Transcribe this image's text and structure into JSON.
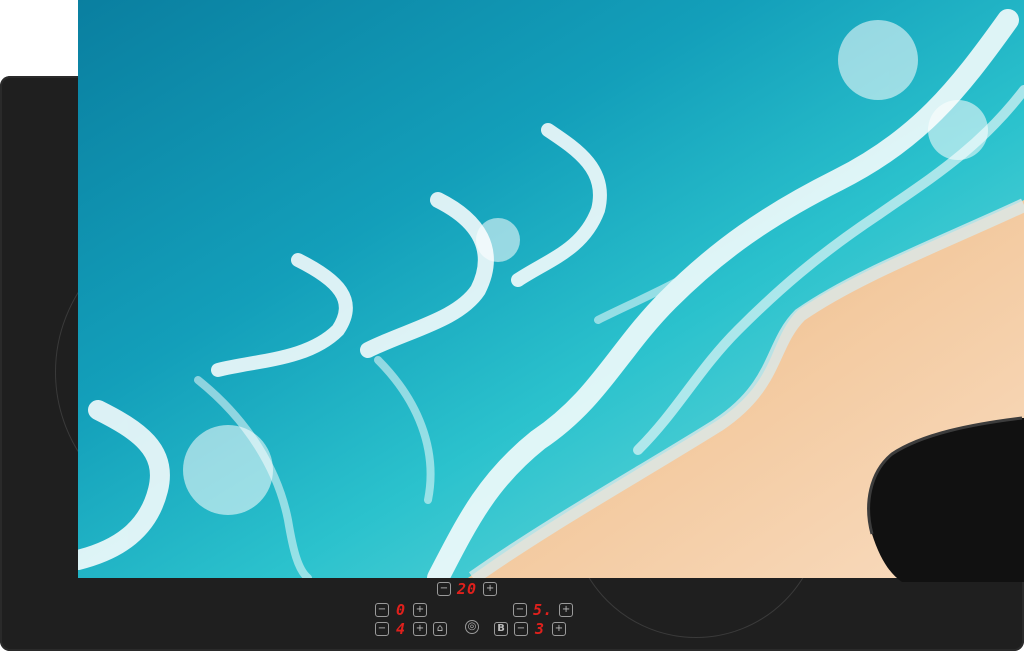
{
  "mat": {
    "theme": "aerial beach with turquoise waves and sand"
  },
  "colors": {
    "cooktop": "#1f1f1f",
    "display_red": "#e0201c",
    "ocean": "#1aa8bf",
    "sand": "#f4c89b"
  },
  "controls": {
    "timer": {
      "minus": "−",
      "value": "20",
      "plus": "+"
    },
    "zone_left_top": {
      "minus": "−",
      "value": "0",
      "plus": "+"
    },
    "zone_left_bottom": {
      "minus": "−",
      "value": "4",
      "plus": "+"
    },
    "zone_right_top": {
      "minus": "−",
      "value": "5.",
      "plus": "+"
    },
    "zone_right_bottom": {
      "minus": "−",
      "value": "3",
      "plus": "+"
    },
    "lock_icon": "lock-icon",
    "power_icon": "power-icon",
    "boost_label": "B"
  }
}
